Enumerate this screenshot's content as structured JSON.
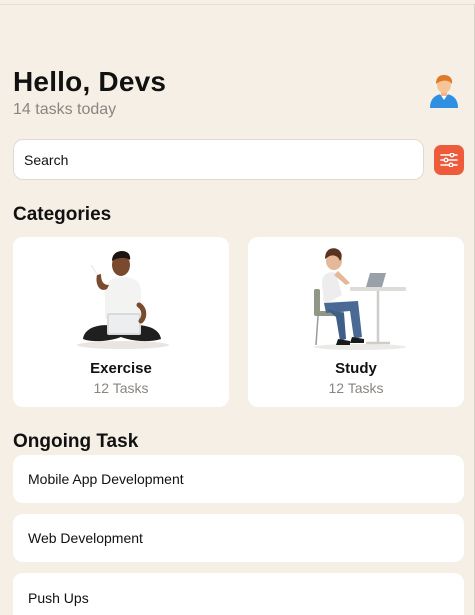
{
  "header": {
    "greeting": "Hello, Devs",
    "subtitle": "14 tasks today",
    "avatar_icon": "person-avatar-icon"
  },
  "search": {
    "placeholder": "Search",
    "filter_icon": "sliders-icon",
    "filter_color": "#ef5a3a"
  },
  "categories": {
    "title": "Categories",
    "items": [
      {
        "name": "Exercise",
        "count": "12 Tasks",
        "icon": "person-with-laptop-illustration"
      },
      {
        "name": "Study",
        "count": "12 Tasks",
        "icon": "person-at-desk-illustration"
      }
    ]
  },
  "ongoing": {
    "title": "Ongoing Task",
    "tasks": [
      {
        "label": "Mobile App Development"
      },
      {
        "label": "Web Development"
      },
      {
        "label": "Push Ups"
      }
    ]
  },
  "colors": {
    "background": "#f6efe6",
    "card": "#ffffff",
    "accent": "#ef5a3a",
    "muted_text": "#8a8580"
  }
}
